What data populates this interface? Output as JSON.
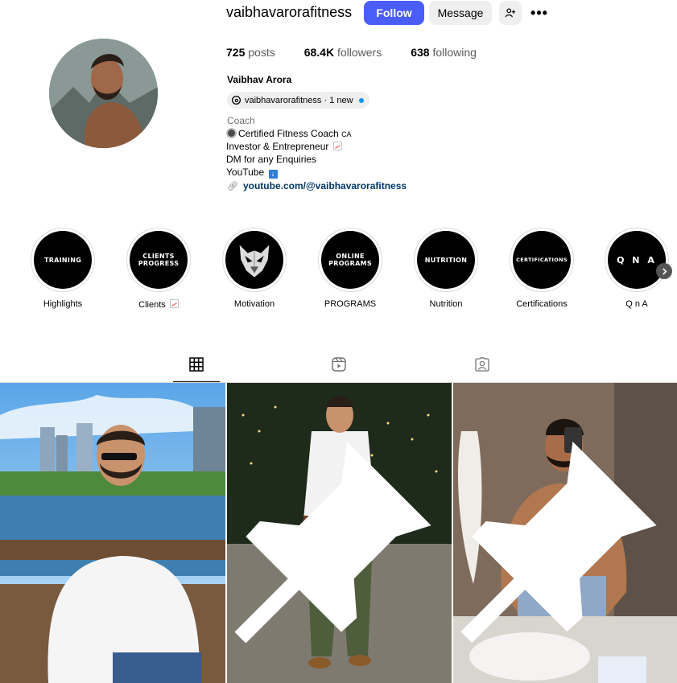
{
  "profile": {
    "username": "vaibhavarorafitness",
    "full_name": "Vaibhav Arora",
    "threads_badge": "vaibhavarorafitness · 1 new",
    "category": "Coach",
    "bio_lines": [
      "Certified Fitness Coach",
      "Investor & Entrepreneur",
      "DM for any Enquiries",
      "YouTube"
    ],
    "bio_ca": "CA",
    "link": "youtube.com/@vaibhavarorafitness"
  },
  "actions": {
    "follow": "Follow",
    "message": "Message",
    "more": "•••"
  },
  "stats": {
    "posts_count": "725",
    "posts_label": "posts",
    "followers_count": "68.4K",
    "followers_label": "followers",
    "following_count": "638",
    "following_label": "following"
  },
  "highlights": [
    {
      "cover_text": "TRAINING",
      "label": "Highlights"
    },
    {
      "cover_text": "CLIENTS PROGRESS",
      "label": "Clients"
    },
    {
      "cover_text": "",
      "label": "Motivation"
    },
    {
      "cover_text": "ONLINE PROGRAMS",
      "label": "PROGRAMS"
    },
    {
      "cover_text": "NUTRITION",
      "label": "Nutrition"
    },
    {
      "cover_text": "CERTIFICATIONS",
      "label": "Certifications"
    },
    {
      "cover_text": "Q N A",
      "label": "Q n A"
    }
  ],
  "tabs": [
    "posts-grid",
    "reels",
    "tagged"
  ],
  "posts": [
    {
      "pinned": false
    },
    {
      "pinned": true
    },
    {
      "pinned": true
    }
  ],
  "colors": {
    "follow_button": "#4a5df9",
    "link": "#00376b",
    "secondary_text": "#737373",
    "button_gray": "#efefef"
  }
}
